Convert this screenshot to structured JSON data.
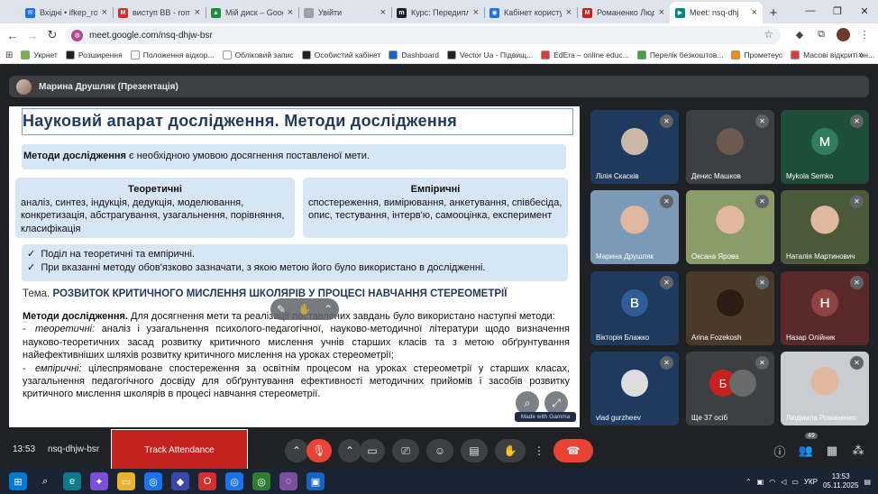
{
  "tabs": [
    {
      "label": "Вхідні • ifkep_rom",
      "fav_color": "#1a73e8",
      "fav_glyph": "✉"
    },
    {
      "label": "виступ ВВ - romar",
      "fav_color": "#d93025",
      "fav_glyph": "M"
    },
    {
      "label": "Мій диск – Google",
      "fav_color": "#1e8e3e",
      "fav_glyph": "▲"
    },
    {
      "label": "Увійти",
      "fav_color": "#9aa0a6",
      "fav_glyph": "◌"
    },
    {
      "label": "Курс: Передиплом",
      "fav_color": "#202124",
      "fav_glyph": "m"
    },
    {
      "label": "Кабінет користувач",
      "fav_color": "#1a73e8",
      "fav_glyph": "◉"
    },
    {
      "label": "Романенко Людм",
      "fav_color": "#c5221f",
      "fav_glyph": "M"
    },
    {
      "label": "Meet: nsq-dhj",
      "fav_color": "#00897b",
      "fav_glyph": "▶",
      "active": true
    }
  ],
  "address": {
    "url": "meet.google.com/nsq-dhjw-bsr"
  },
  "bookmarks": [
    {
      "label": "Укрнет",
      "color": "#7cb342"
    },
    {
      "label": "Розширення",
      "color": "#212121"
    },
    {
      "label": "Положення відкор...",
      "color": "#ffffff"
    },
    {
      "label": "Обліковий запис",
      "color": "#ffffff"
    },
    {
      "label": "Особистий кабінет",
      "color": "#212121"
    },
    {
      "label": "Dashboard",
      "color": "#1565c0"
    },
    {
      "label": "Vector Ua - Підвищ...",
      "color": "#212121"
    },
    {
      "label": "EdEra – online educ...",
      "color": "#e53935"
    },
    {
      "label": "Перелік безкоштов...",
      "color": "#43a047"
    },
    {
      "label": "Прометеус",
      "color": "#fb8c00"
    },
    {
      "label": "Масові відкриті он...",
      "color": "#e53935"
    }
  ],
  "presenter": {
    "name": "Марина Друшляк (Презентація)"
  },
  "slide": {
    "title": "Науковий апарат дослідження. Методи дослідження",
    "box1_bold": "Методи дослідження",
    "box1_rest": " є необхідною умовою досягнення поставленої мети.",
    "col1_head": "Теоретичні",
    "col1_body": "аналіз, синтез, індукція, дедукція, моделювання, конкретизація, абстрагування, узагальнення, порівняння, класифікація",
    "col2_head": "Емпіричні",
    "col2_body": "спостереження, вимірювання, анкетування, співбесіда, опис, тестування, інтерв'ю, самооцінка, експеримент",
    "bullet1": "Поділ на теоретичні та емпіричні.",
    "bullet2": "При вказанні методу обов'язково зазначати, з якою метою його було використано в дослідженні.",
    "tema_label": "Тема. ",
    "tema_text": "РОЗВИТОК КРИТИЧНОГО МИСЛЕННЯ ШКОЛЯРІВ У ПРОЦЕСІ НАВЧАННЯ СТЕРЕОМЕТРІЇ",
    "methods_bold": "Методи дослідження.",
    "methods_rest": " Для досягнення мети та реалізації поставлених завдань було використано наступні методи:",
    "theor_label": "теоретичні:",
    "theor_text": " аналіз і узагальнення психолого-педагогічної, науково-методичної літератури щодо визначення науково-теоретичних засад розвитку критичного мислення учнів старших класів та з метою обґрунтування найефективніших шляхів розвитку критичного мислення на уроках стереометрії;",
    "emp_label": "емпіричні:",
    "emp_text": " цілеспрямоване спостереження за освітнім процесом на уроках стереометрії у старших класах, узагальнення педагогічного досвіду для обґрунтування ефективності методичних прийомів і засобів розвитку критичного мислення школярів в процесі навчання стереометрії.",
    "made_with": "Made with Gamma"
  },
  "tiles": [
    {
      "name": "Лілія Скасків",
      "type": "photo",
      "bg": "#1e3a5f",
      "avatar": "#c9b8aa"
    },
    {
      "name": "Денис Машков",
      "type": "photo",
      "bg": "#3c4043",
      "avatar": "#6d5a4f"
    },
    {
      "name": "Mykola Semko",
      "type": "letter",
      "bg": "#1e4e3a",
      "letter": "M",
      "letter_bg": "#1e4e3a"
    },
    {
      "name": "Марина Друшляк",
      "type": "video",
      "bg": "#7a9ab8"
    },
    {
      "name": "Оксана Ярова",
      "type": "video",
      "bg": "#8a9c6a"
    },
    {
      "name": "Наталія Мартинович",
      "type": "video",
      "bg": "#4a5a3a"
    },
    {
      "name": "Вікторія Блажко",
      "type": "letter",
      "bg": "#1e3a5f",
      "letter": "В",
      "letter_bg": "#1e3a5f"
    },
    {
      "name": "Arina Fozekosh",
      "type": "photo",
      "bg": "#4a3a2a",
      "avatar": "#2a1e14"
    },
    {
      "name": "Назар Олійник",
      "type": "letter",
      "bg": "#5a2a2a",
      "letter": "Н",
      "letter_bg": "#5a2a2a"
    },
    {
      "name": "vlad gurzheev",
      "type": "photo",
      "bg": "#1e3a5f",
      "avatar": "#dddddd"
    },
    {
      "name": "Ще 37 осіб",
      "type": "more",
      "bg": "#3c4043"
    },
    {
      "name": "Людмила Романенко",
      "type": "video",
      "bg": "#c9ccd0"
    }
  ],
  "bottom": {
    "time": "13:53",
    "code": "nsq-dhjw-bsr",
    "track": "Track Attendance",
    "people_count": "49"
  },
  "taskbar": {
    "lang": "УКР",
    "time": "13:53",
    "date": "05.11.2025"
  }
}
